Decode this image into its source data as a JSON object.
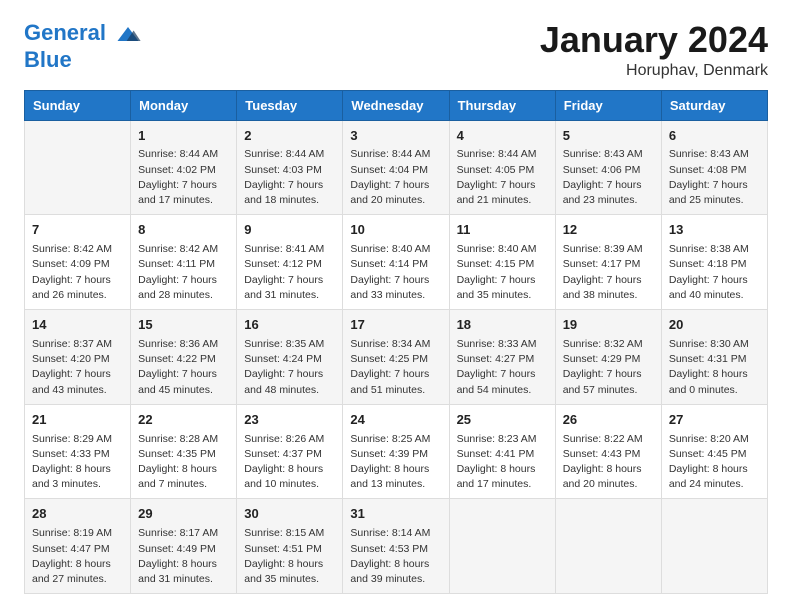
{
  "header": {
    "logo_line1": "General",
    "logo_line2": "Blue",
    "month": "January 2024",
    "location": "Horuphav, Denmark"
  },
  "weekdays": [
    "Sunday",
    "Monday",
    "Tuesday",
    "Wednesday",
    "Thursday",
    "Friday",
    "Saturday"
  ],
  "weeks": [
    [
      {
        "day": "",
        "info": ""
      },
      {
        "day": "1",
        "info": "Sunrise: 8:44 AM\nSunset: 4:02 PM\nDaylight: 7 hours\nand 17 minutes."
      },
      {
        "day": "2",
        "info": "Sunrise: 8:44 AM\nSunset: 4:03 PM\nDaylight: 7 hours\nand 18 minutes."
      },
      {
        "day": "3",
        "info": "Sunrise: 8:44 AM\nSunset: 4:04 PM\nDaylight: 7 hours\nand 20 minutes."
      },
      {
        "day": "4",
        "info": "Sunrise: 8:44 AM\nSunset: 4:05 PM\nDaylight: 7 hours\nand 21 minutes."
      },
      {
        "day": "5",
        "info": "Sunrise: 8:43 AM\nSunset: 4:06 PM\nDaylight: 7 hours\nand 23 minutes."
      },
      {
        "day": "6",
        "info": "Sunrise: 8:43 AM\nSunset: 4:08 PM\nDaylight: 7 hours\nand 25 minutes."
      }
    ],
    [
      {
        "day": "7",
        "info": "Sunrise: 8:42 AM\nSunset: 4:09 PM\nDaylight: 7 hours\nand 26 minutes."
      },
      {
        "day": "8",
        "info": "Sunrise: 8:42 AM\nSunset: 4:11 PM\nDaylight: 7 hours\nand 28 minutes."
      },
      {
        "day": "9",
        "info": "Sunrise: 8:41 AM\nSunset: 4:12 PM\nDaylight: 7 hours\nand 31 minutes."
      },
      {
        "day": "10",
        "info": "Sunrise: 8:40 AM\nSunset: 4:14 PM\nDaylight: 7 hours\nand 33 minutes."
      },
      {
        "day": "11",
        "info": "Sunrise: 8:40 AM\nSunset: 4:15 PM\nDaylight: 7 hours\nand 35 minutes."
      },
      {
        "day": "12",
        "info": "Sunrise: 8:39 AM\nSunset: 4:17 PM\nDaylight: 7 hours\nand 38 minutes."
      },
      {
        "day": "13",
        "info": "Sunrise: 8:38 AM\nSunset: 4:18 PM\nDaylight: 7 hours\nand 40 minutes."
      }
    ],
    [
      {
        "day": "14",
        "info": "Sunrise: 8:37 AM\nSunset: 4:20 PM\nDaylight: 7 hours\nand 43 minutes."
      },
      {
        "day": "15",
        "info": "Sunrise: 8:36 AM\nSunset: 4:22 PM\nDaylight: 7 hours\nand 45 minutes."
      },
      {
        "day": "16",
        "info": "Sunrise: 8:35 AM\nSunset: 4:24 PM\nDaylight: 7 hours\nand 48 minutes."
      },
      {
        "day": "17",
        "info": "Sunrise: 8:34 AM\nSunset: 4:25 PM\nDaylight: 7 hours\nand 51 minutes."
      },
      {
        "day": "18",
        "info": "Sunrise: 8:33 AM\nSunset: 4:27 PM\nDaylight: 7 hours\nand 54 minutes."
      },
      {
        "day": "19",
        "info": "Sunrise: 8:32 AM\nSunset: 4:29 PM\nDaylight: 7 hours\nand 57 minutes."
      },
      {
        "day": "20",
        "info": "Sunrise: 8:30 AM\nSunset: 4:31 PM\nDaylight: 8 hours\nand 0 minutes."
      }
    ],
    [
      {
        "day": "21",
        "info": "Sunrise: 8:29 AM\nSunset: 4:33 PM\nDaylight: 8 hours\nand 3 minutes."
      },
      {
        "day": "22",
        "info": "Sunrise: 8:28 AM\nSunset: 4:35 PM\nDaylight: 8 hours\nand 7 minutes."
      },
      {
        "day": "23",
        "info": "Sunrise: 8:26 AM\nSunset: 4:37 PM\nDaylight: 8 hours\nand 10 minutes."
      },
      {
        "day": "24",
        "info": "Sunrise: 8:25 AM\nSunset: 4:39 PM\nDaylight: 8 hours\nand 13 minutes."
      },
      {
        "day": "25",
        "info": "Sunrise: 8:23 AM\nSunset: 4:41 PM\nDaylight: 8 hours\nand 17 minutes."
      },
      {
        "day": "26",
        "info": "Sunrise: 8:22 AM\nSunset: 4:43 PM\nDaylight: 8 hours\nand 20 minutes."
      },
      {
        "day": "27",
        "info": "Sunrise: 8:20 AM\nSunset: 4:45 PM\nDaylight: 8 hours\nand 24 minutes."
      }
    ],
    [
      {
        "day": "28",
        "info": "Sunrise: 8:19 AM\nSunset: 4:47 PM\nDaylight: 8 hours\nand 27 minutes."
      },
      {
        "day": "29",
        "info": "Sunrise: 8:17 AM\nSunset: 4:49 PM\nDaylight: 8 hours\nand 31 minutes."
      },
      {
        "day": "30",
        "info": "Sunrise: 8:15 AM\nSunset: 4:51 PM\nDaylight: 8 hours\nand 35 minutes."
      },
      {
        "day": "31",
        "info": "Sunrise: 8:14 AM\nSunset: 4:53 PM\nDaylight: 8 hours\nand 39 minutes."
      },
      {
        "day": "",
        "info": ""
      },
      {
        "day": "",
        "info": ""
      },
      {
        "day": "",
        "info": ""
      }
    ]
  ]
}
